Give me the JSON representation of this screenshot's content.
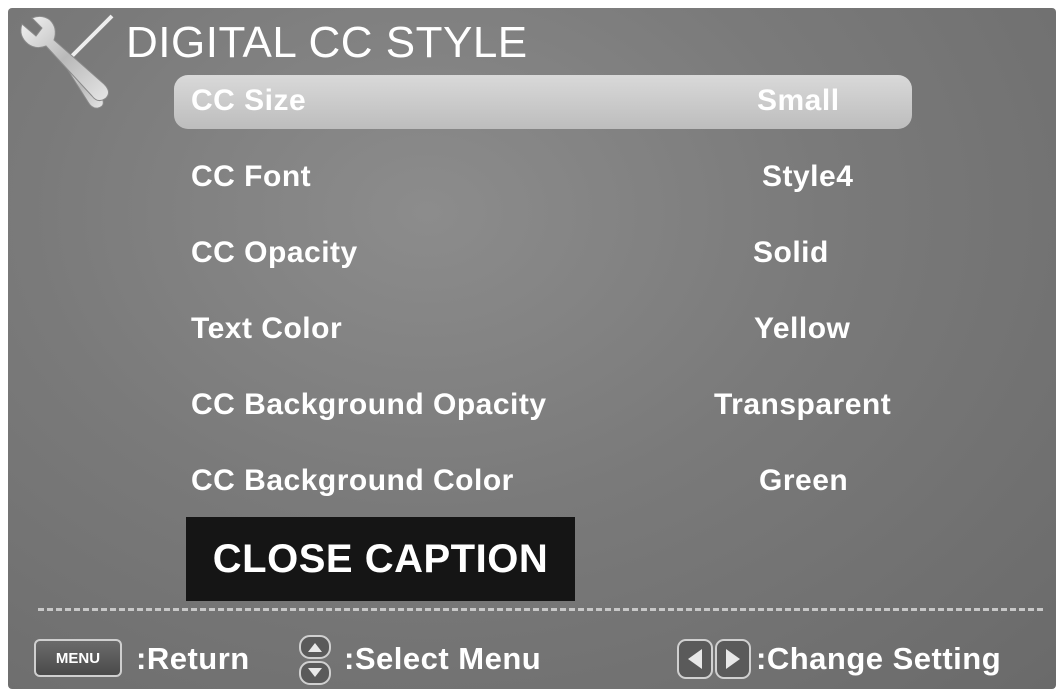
{
  "header": {
    "title": "DIGITAL CC STYLE",
    "icon": "tools-icon"
  },
  "menu_items": [
    {
      "label": "CC Size",
      "value": "Small",
      "selected": true
    },
    {
      "label": "CC Font",
      "value": "Style4",
      "selected": false
    },
    {
      "label": "CC Opacity",
      "value": "Solid",
      "selected": false
    },
    {
      "label": "Text Color",
      "value": "Yellow",
      "selected": false
    },
    {
      "label": "CC Background Opacity",
      "value": "Transparent",
      "selected": false
    },
    {
      "label": "CC Background Color",
      "value": "Green",
      "selected": false
    }
  ],
  "preview": {
    "text": "CLOSE CAPTION"
  },
  "footer": {
    "menu_key": "MENU",
    "return_label": ":Return",
    "select_label": ":Select Menu",
    "change_label": ":Change Setting"
  }
}
